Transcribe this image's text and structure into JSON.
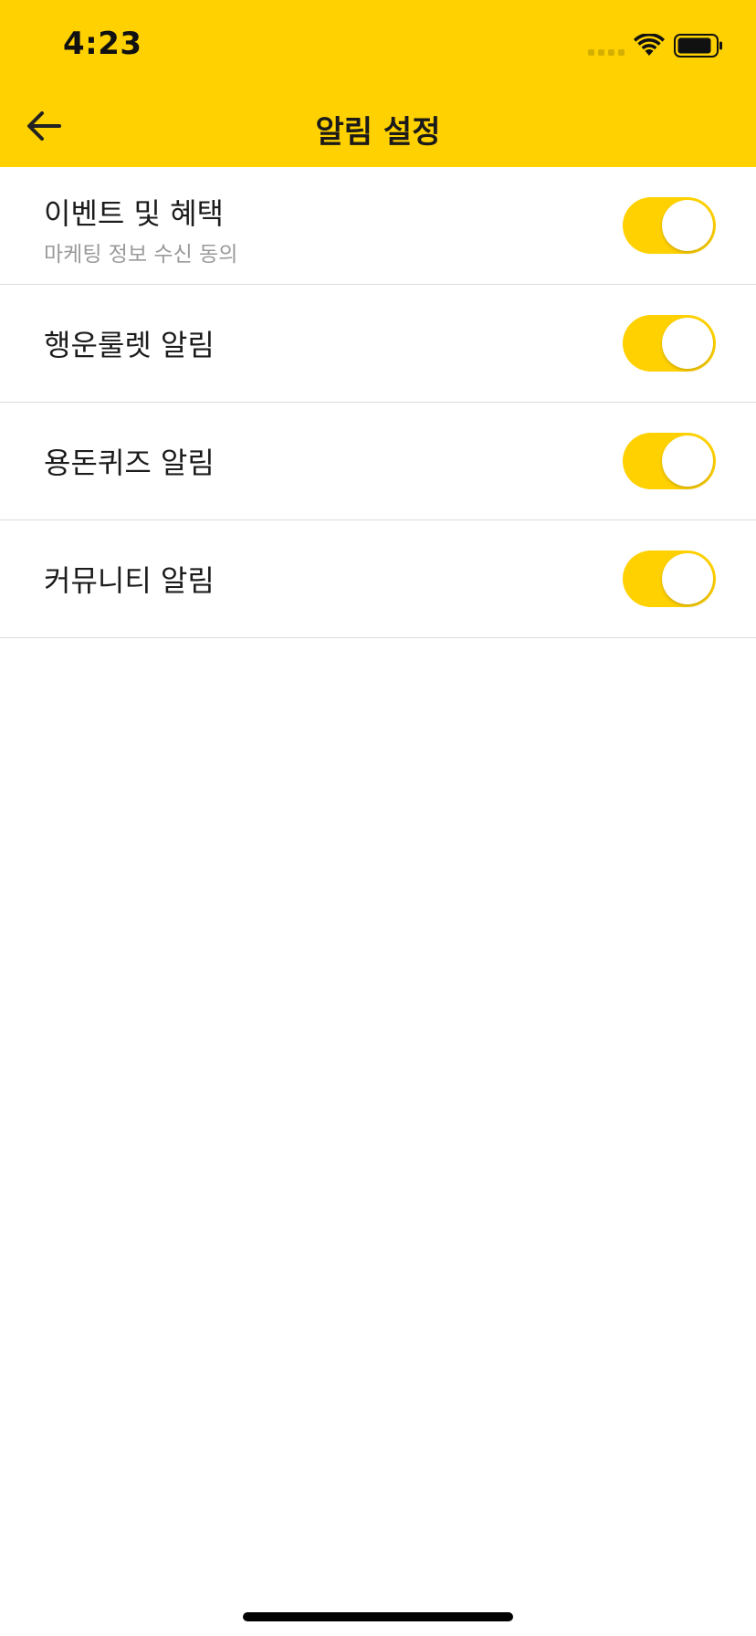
{
  "status_bar": {
    "time": "4:23",
    "icons": [
      "signal-dots-icon",
      "wifi-icon",
      "battery-icon"
    ]
  },
  "nav": {
    "back_icon": "back-arrow-icon",
    "title": "알림 설정"
  },
  "colors": {
    "accent": "#FFD100",
    "text": "#1c1c1c",
    "subtext": "#9a9a9a",
    "divider": "#dcdcdc"
  },
  "settings": [
    {
      "label": "이벤트 및 혜택",
      "sublabel": "마케팅 정보 수신 동의",
      "enabled": true
    },
    {
      "label": "행운룰렛 알림",
      "enabled": true
    },
    {
      "label": "용돈퀴즈 알림",
      "enabled": true
    },
    {
      "label": "커뮤니티 알림",
      "enabled": true
    }
  ]
}
